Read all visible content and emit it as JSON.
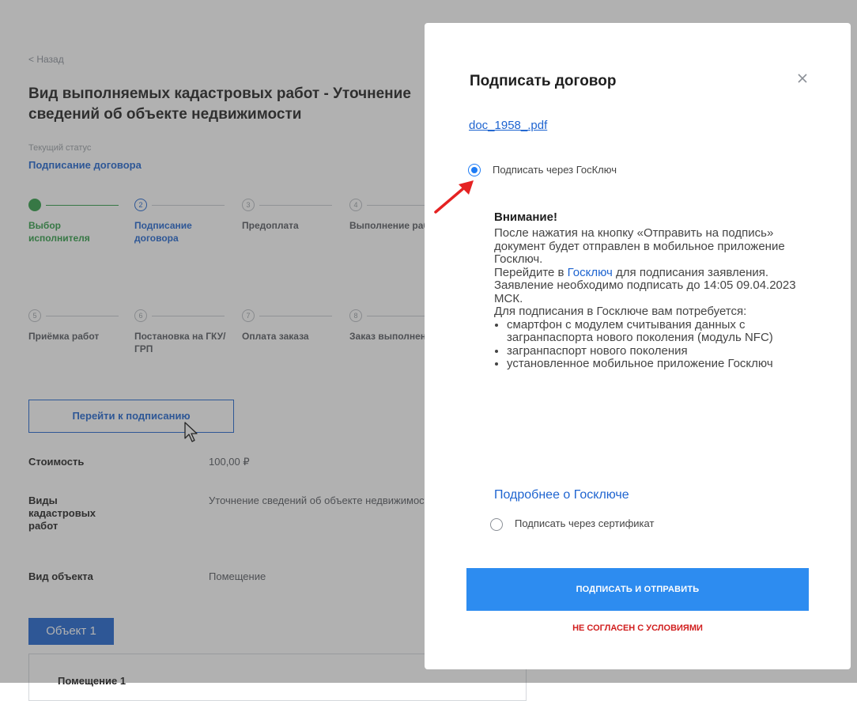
{
  "page": {
    "back_label": "< Назад",
    "title": "Вид выполняемых кадастровых работ - Уточнение сведений об объекте недвижимости",
    "status_label": "Текущий статус",
    "status_value": "Подписание договора",
    "steps_row1": [
      {
        "num": "✓",
        "label": "Выбор исполнителя",
        "state": "done"
      },
      {
        "num": "2",
        "label": "Подписание договора",
        "state": "active"
      },
      {
        "num": "3",
        "label": "Предоплата",
        "state": "pending"
      },
      {
        "num": "4",
        "label": "Выполнение работ",
        "state": "pending"
      }
    ],
    "steps_row2": [
      {
        "num": "5",
        "label": "Приёмка работ",
        "state": "pending"
      },
      {
        "num": "6",
        "label": "Постановка на ГКУ/ГРП",
        "state": "pending"
      },
      {
        "num": "7",
        "label": "Оплата заказа",
        "state": "pending"
      },
      {
        "num": "8",
        "label": "Заказ выполнен",
        "state": "pending"
      }
    ],
    "go_button": "Перейти к подписанию",
    "info": [
      {
        "key": "Стоимость",
        "value": "100,00 ₽"
      },
      {
        "key": "Виды кадастровых работ",
        "value": "Уточнение сведений об объекте недвижимости"
      },
      {
        "key": "Вид объекта",
        "value": "Помещение"
      }
    ],
    "object_tab": "Объект 1",
    "object_card_title": "Помещение 1"
  },
  "modal": {
    "title": "Подписать договор",
    "close_icon": "close-icon",
    "document_link": "doc_1958_.pdf",
    "option_goskey": "Подписать через ГосКлюч",
    "warning_title": "Внимание!",
    "warning_p1": "После нажатия на кнопку «Отправить на подпись» документ будет отправлен в мобильное приложение Госключ.",
    "warning_p2_a": "Перейдите в ",
    "warning_p2_link": "Госключ",
    "warning_p2_b": " для подписания заявления. Заявление необходимо подписать до 14:05 09.04.2023 МСК.",
    "warning_p3": "Для подписания в Госключе вам потребуется:",
    "requirements": [
      "смартфон с модулем считывания данных с загранпаспорта нового поколения (модуль NFC)",
      "загранпаспорт нового поколения",
      "установленное мобильное приложение Госключ"
    ],
    "more_link": "Подробнее о Госключе",
    "option_certificate": "Подписать через сертификат",
    "sign_button": "ПОДПИСАТЬ И ОТПРАВИТЬ",
    "decline_button": "НЕ СОГЛАСЕН С УСЛОВИЯМИ",
    "selected_option": "goskey"
  },
  "colors": {
    "accent": "#1e64d0",
    "primary_button": "#2d8cf0",
    "success": "#2e9e46",
    "danger": "#d11f1f",
    "annotation_arrow": "#e52222"
  }
}
